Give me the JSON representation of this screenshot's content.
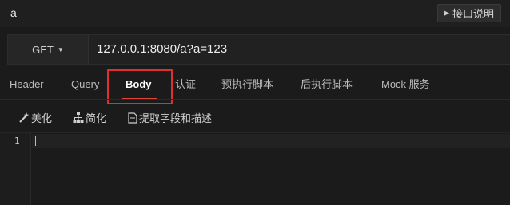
{
  "window": {
    "title": "a",
    "doc_button_label": "接口说明"
  },
  "request": {
    "method": "GET",
    "url": "127.0.0.1:8080/a?a=123"
  },
  "tabs": [
    {
      "label": "Header"
    },
    {
      "label": "Query"
    },
    {
      "label": "Body",
      "active": true
    },
    {
      "label": "认证"
    },
    {
      "label": "预执行脚本"
    },
    {
      "label": "后执行脚本"
    },
    {
      "label": "Mock 服务"
    }
  ],
  "toolbar": {
    "beautify_label": "美化",
    "simplify_label": "简化",
    "extract_label": "提取字段和描述"
  },
  "editor": {
    "line_numbers": [
      "1"
    ]
  },
  "colors": {
    "active_tab_underline": "#e0453b",
    "highlight_box": "#e02f2f",
    "background": "#1b1b1b"
  }
}
